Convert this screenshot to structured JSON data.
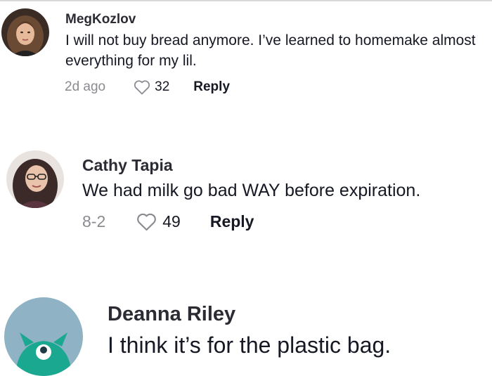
{
  "comments": [
    {
      "username": "MegKozlov",
      "text": "I will not buy bread anymore. I’ve learned to homemake almost everything for my lil.",
      "date": "2d ago",
      "likes": "32",
      "reply_label": "Reply"
    },
    {
      "username": "Cathy Tapia",
      "text": "We had milk go bad WAY before expiration.",
      "date": "8-2",
      "likes": "49",
      "reply_label": "Reply"
    },
    {
      "username": "Deanna Riley",
      "text": "I think it’s for the plastic bag."
    }
  ],
  "icons": {
    "like": "heart-outline-icon"
  },
  "colors": {
    "text": "#161823",
    "muted": "#8a8b91",
    "avatar3_bg": "#8fb3c4",
    "avatar3_figure": "#1ba891"
  }
}
